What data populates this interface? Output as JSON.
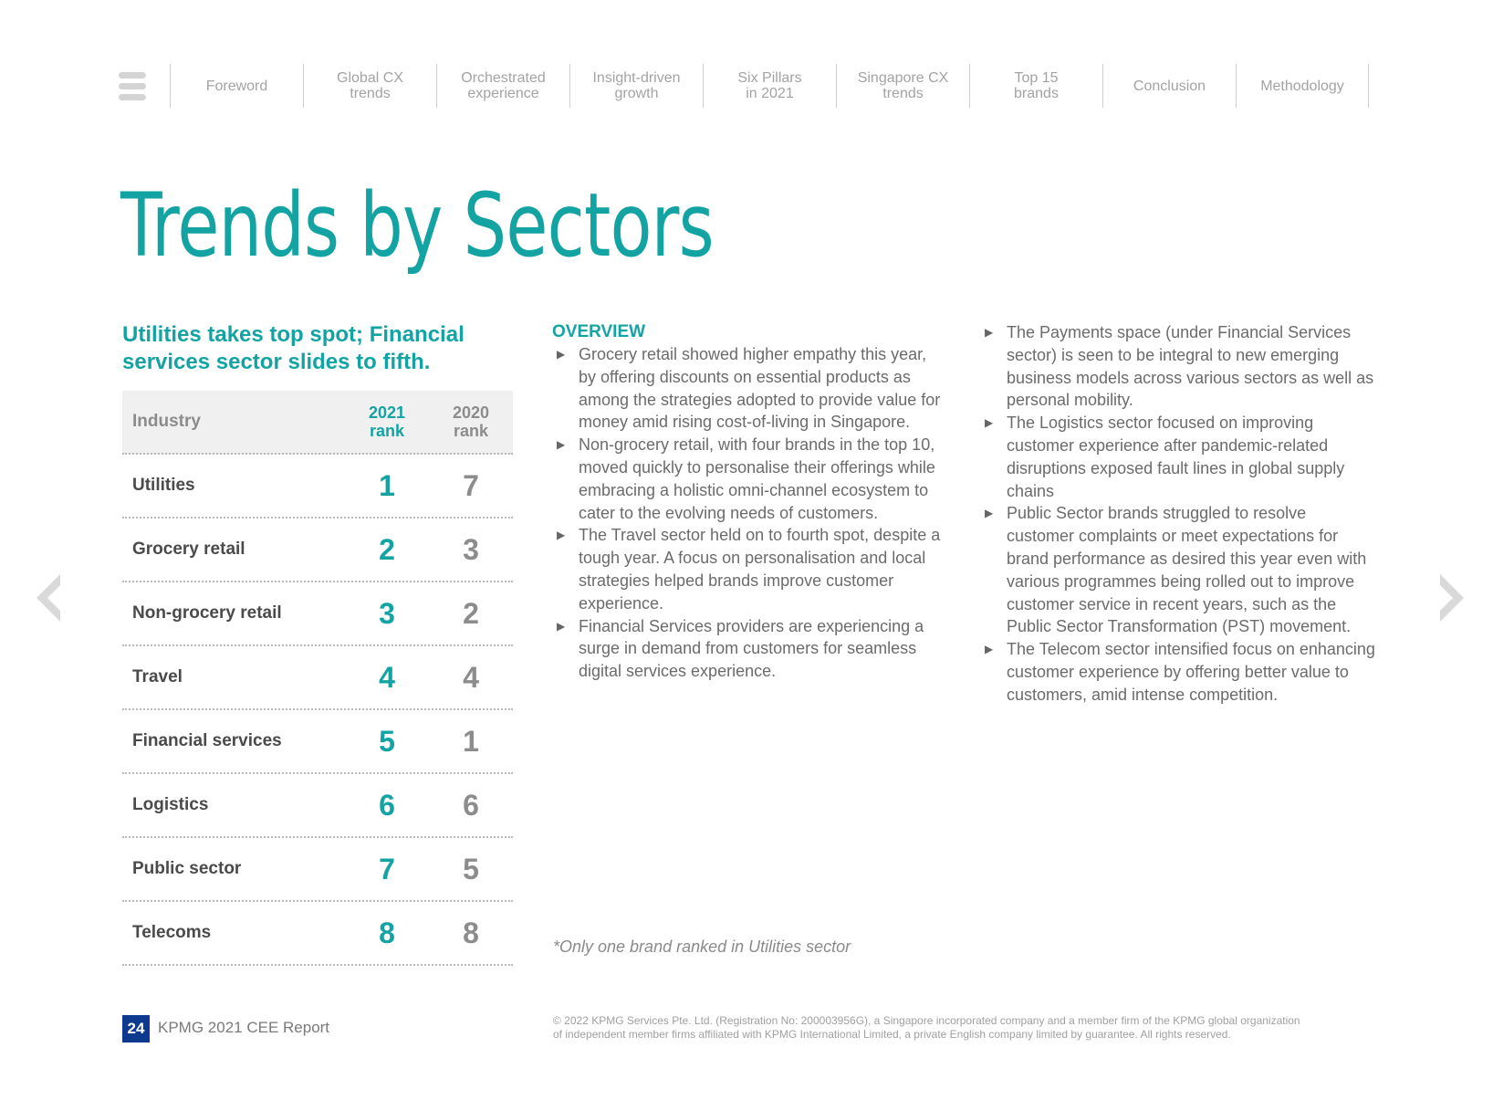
{
  "nav": {
    "menu_icon": "hamburger-menu-icon",
    "items": [
      {
        "label": "Foreword"
      },
      {
        "label": "Global CX\ntrends"
      },
      {
        "label": "Orchestrated\nexperience"
      },
      {
        "label": "Insight-driven\ngrowth"
      },
      {
        "label": "Six Pillars\nin 2021"
      },
      {
        "label": "Singapore CX\ntrends"
      },
      {
        "label": "Top 15\nbrands"
      },
      {
        "label": "Conclusion"
      },
      {
        "label": "Methodology"
      }
    ]
  },
  "title": "Trends by Sectors",
  "headline": "Utilities takes top spot; Financial services sector slides to fifth.",
  "table": {
    "headers": {
      "industry": "Industry",
      "rank_2021": "2021\nrank",
      "rank_2020": "2020\nrank"
    },
    "rows": [
      {
        "industry": "Utilities",
        "rank_2021": "1",
        "rank_2020": "7"
      },
      {
        "industry": "Grocery retail",
        "rank_2021": "2",
        "rank_2020": "3"
      },
      {
        "industry": "Non-grocery retail",
        "rank_2021": "3",
        "rank_2020": "2"
      },
      {
        "industry": "Travel",
        "rank_2021": "4",
        "rank_2020": "4"
      },
      {
        "industry": "Financial services",
        "rank_2021": "5",
        "rank_2020": "1"
      },
      {
        "industry": "Logistics",
        "rank_2021": "6",
        "rank_2020": "6"
      },
      {
        "industry": "Public sector",
        "rank_2021": "7",
        "rank_2020": "5"
      },
      {
        "industry": "Telecoms",
        "rank_2021": "8",
        "rank_2020": "8"
      }
    ]
  },
  "overview": {
    "title": "OVERVIEW",
    "column_1": [
      "Grocery retail showed higher empathy this year, by offering discounts on essential products as among the strategies adopted to provide value for money amid rising cost-of-living in Singapore.",
      "Non-grocery retail, with four brands in the top 10, moved quickly to personalise their offerings while embracing a holistic omni-channel ecosystem to cater to the evolving needs of customers.",
      "The Travel sector held on to fourth spot, despite a tough year. A focus on personalisation and local strategies helped brands improve customer experience.",
      "Financial Services providers are experiencing a surge in demand from customers for seamless digital services experience."
    ],
    "column_2": [
      "The Payments space (under Financial Services sector) is seen to be integral to new emerging business models across various sectors as well as personal mobility.",
      "The Logistics sector focused on improving customer experience after pandemic-related disruptions exposed fault lines in global supply chains",
      "Public Sector brands struggled to resolve customer complaints or meet expectations for brand performance as desired this year even with various programmes being rolled out to improve customer service in recent years, such as the Public Sector Transformation (PST) movement.",
      "The Telecom sector intensified focus on enhancing customer experience by offering better value to customers, amid intense competition."
    ]
  },
  "footnote": "*Only one brand ranked in Utilities sector",
  "footer": {
    "page_number": "24",
    "report_name": "KPMG 2021 CEE Report",
    "copyright_line_1": "© 2022 KPMG Services Pte. Ltd. (Registration No: 200003956G), a Singapore incorporated company and a member firm of the KPMG global organization",
    "copyright_line_2": "of independent member firms affiliated with KPMG International Limited, a private English company limited by guarantee. All rights reserved."
  },
  "arrows": {
    "prev_icon": "chevron-left-icon",
    "next_icon": "chevron-right-icon"
  },
  "colors": {
    "accent": "#14a3a3",
    "text": "#6b6b6b",
    "page_badge": "#0d3a8e",
    "nav_text": "#a3a3a3"
  }
}
